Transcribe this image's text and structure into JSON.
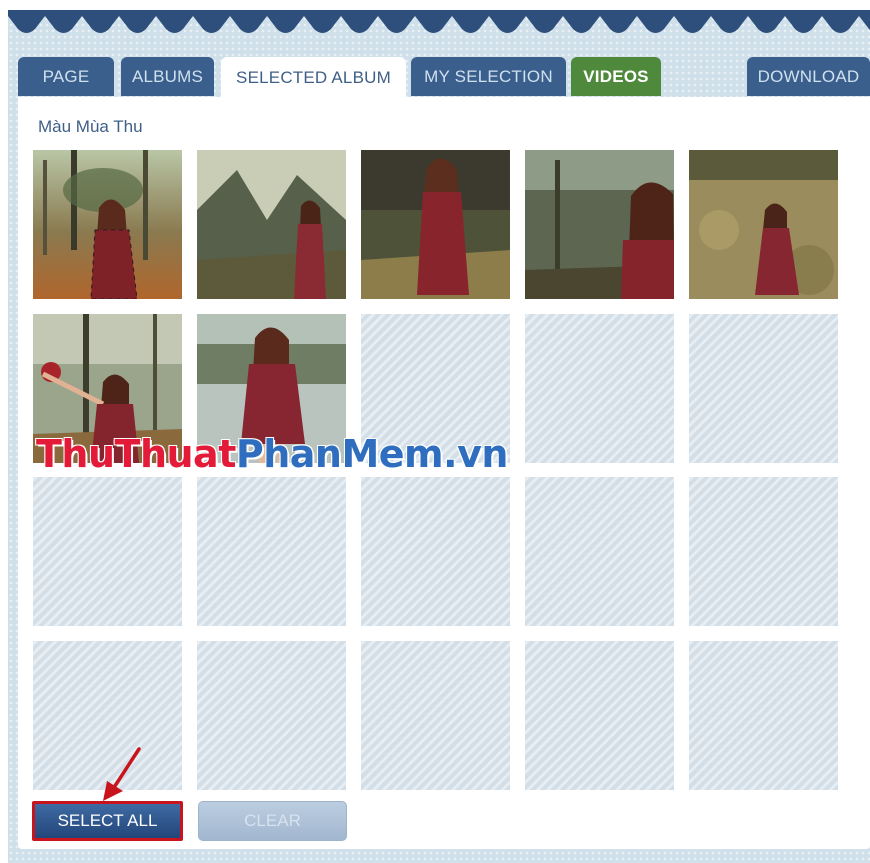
{
  "tabs": [
    {
      "label": "PAGE"
    },
    {
      "label": "ALBUMS"
    },
    {
      "label": "SELECTED ALBUM"
    },
    {
      "label": "MY SELECTION"
    },
    {
      "label": "VIDEOS"
    },
    {
      "label": "DOWNLOAD"
    }
  ],
  "album": {
    "title": "Màu Mùa Thu",
    "photos": [
      {
        "name": "photo-1"
      },
      {
        "name": "photo-2"
      },
      {
        "name": "photo-3"
      },
      {
        "name": "photo-4"
      },
      {
        "name": "photo-5"
      },
      {
        "name": "photo-6"
      },
      {
        "name": "photo-7"
      }
    ],
    "empty_slots": 13
  },
  "buttons": {
    "select_all": "SELECT ALL",
    "clear": "CLEAR"
  },
  "watermark": {
    "part1": "ThuThuat",
    "part2": "PhanMem.vn"
  },
  "colors": {
    "tab_bg": "#3b5f8c",
    "tab_active_bg": "#ffffff",
    "videos_tab_bg": "#4f8a3c",
    "accent_red": "#c8141c"
  }
}
